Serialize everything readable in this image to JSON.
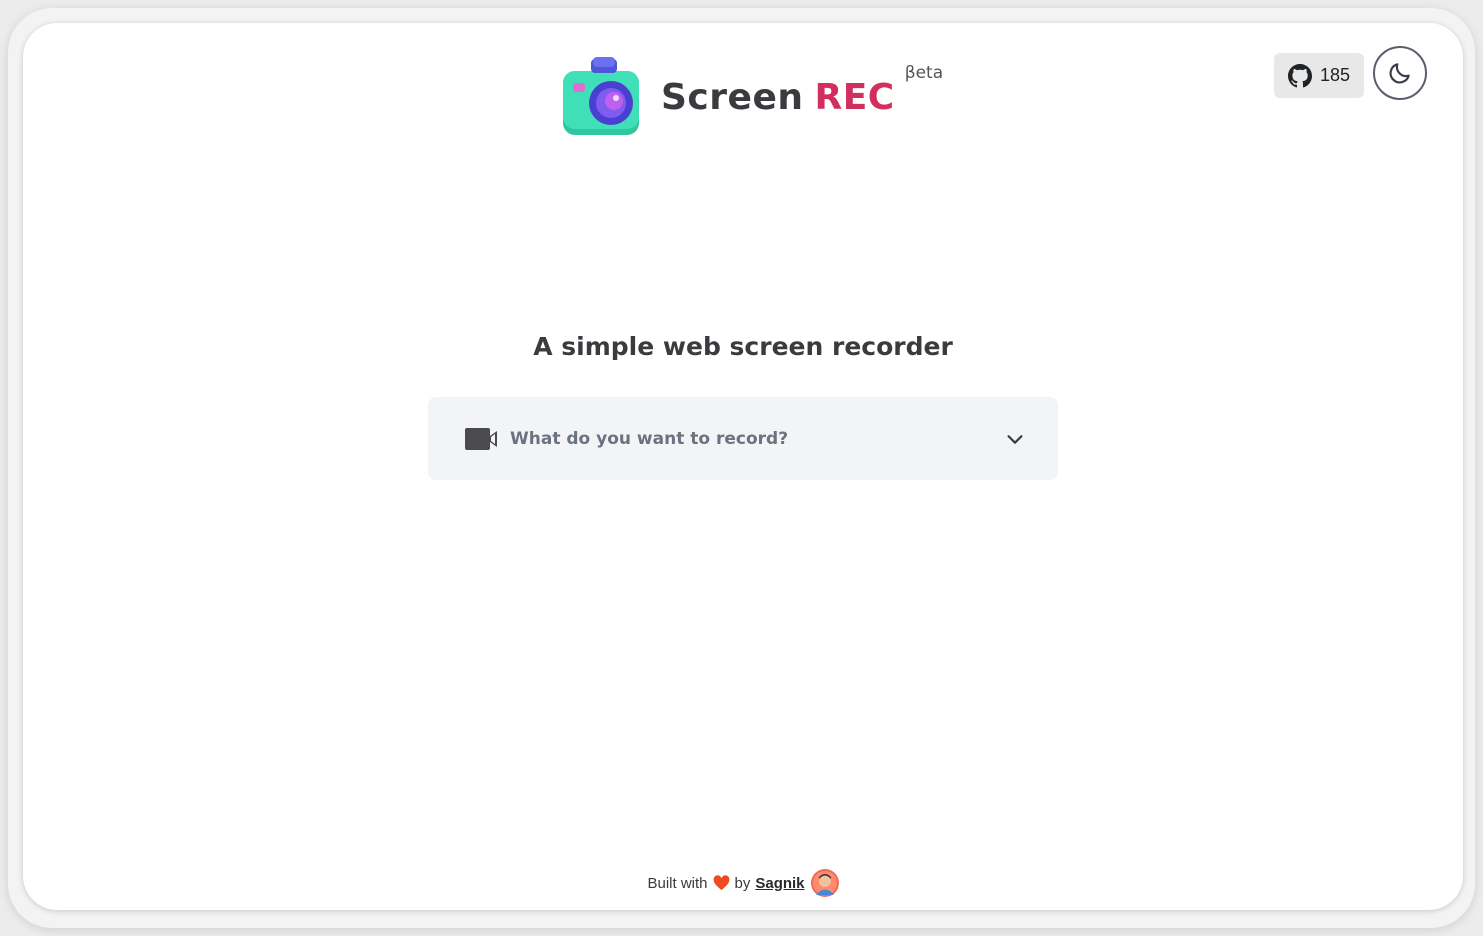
{
  "header": {
    "brand_part1": "Screen",
    "brand_part2": "REC",
    "badge": "βeta",
    "logo_icon": "camera-icon"
  },
  "github": {
    "icon": "github-icon",
    "star_count": "185"
  },
  "theme_toggle": {
    "icon": "moon-icon"
  },
  "main": {
    "title": "A simple web screen recorder",
    "select": {
      "icon": "video-camera-icon",
      "placeholder": "What do you want to record?",
      "caret": "chevron-down-icon"
    }
  },
  "footer": {
    "built_with": "Built with",
    "by": "by",
    "author": "Sagnik",
    "heart_icon": "heart-icon",
    "avatar": "avatar"
  },
  "colors": {
    "brand_dark": "#3b3b3f",
    "brand_accent": "#d22e5e",
    "select_bg": "#f3f4f6",
    "select_text": "#6b7280",
    "heart": "#f04a22"
  }
}
